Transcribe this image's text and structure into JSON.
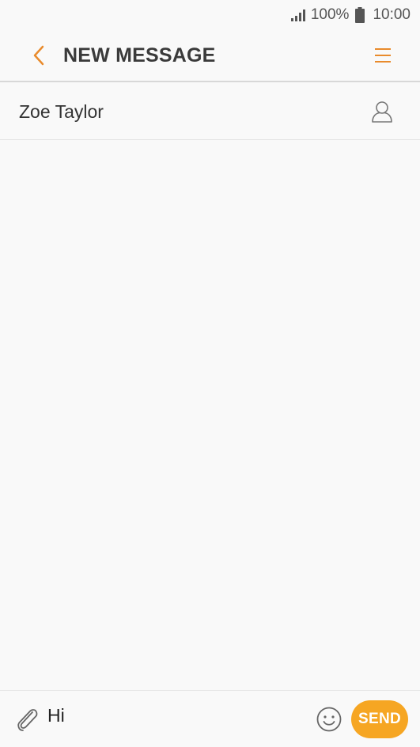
{
  "status_bar": {
    "battery_level": "100%",
    "time": "10:00"
  },
  "app_bar": {
    "title": "NEW MESSAGE",
    "back_icon": "chevron-left-icon",
    "menu_icon": "hamburger-menu-icon"
  },
  "recipient": {
    "name": "Zoe Taylor",
    "contact_icon": "person-icon"
  },
  "composer": {
    "message_value": "Hi",
    "attach_icon": "paperclip-icon",
    "emoji_icon": "smiley-icon",
    "send_label": "SEND"
  },
  "colors": {
    "accent": "#f6a623",
    "back_and_menu": "#e98b2c",
    "background": "#f9f9f9"
  }
}
